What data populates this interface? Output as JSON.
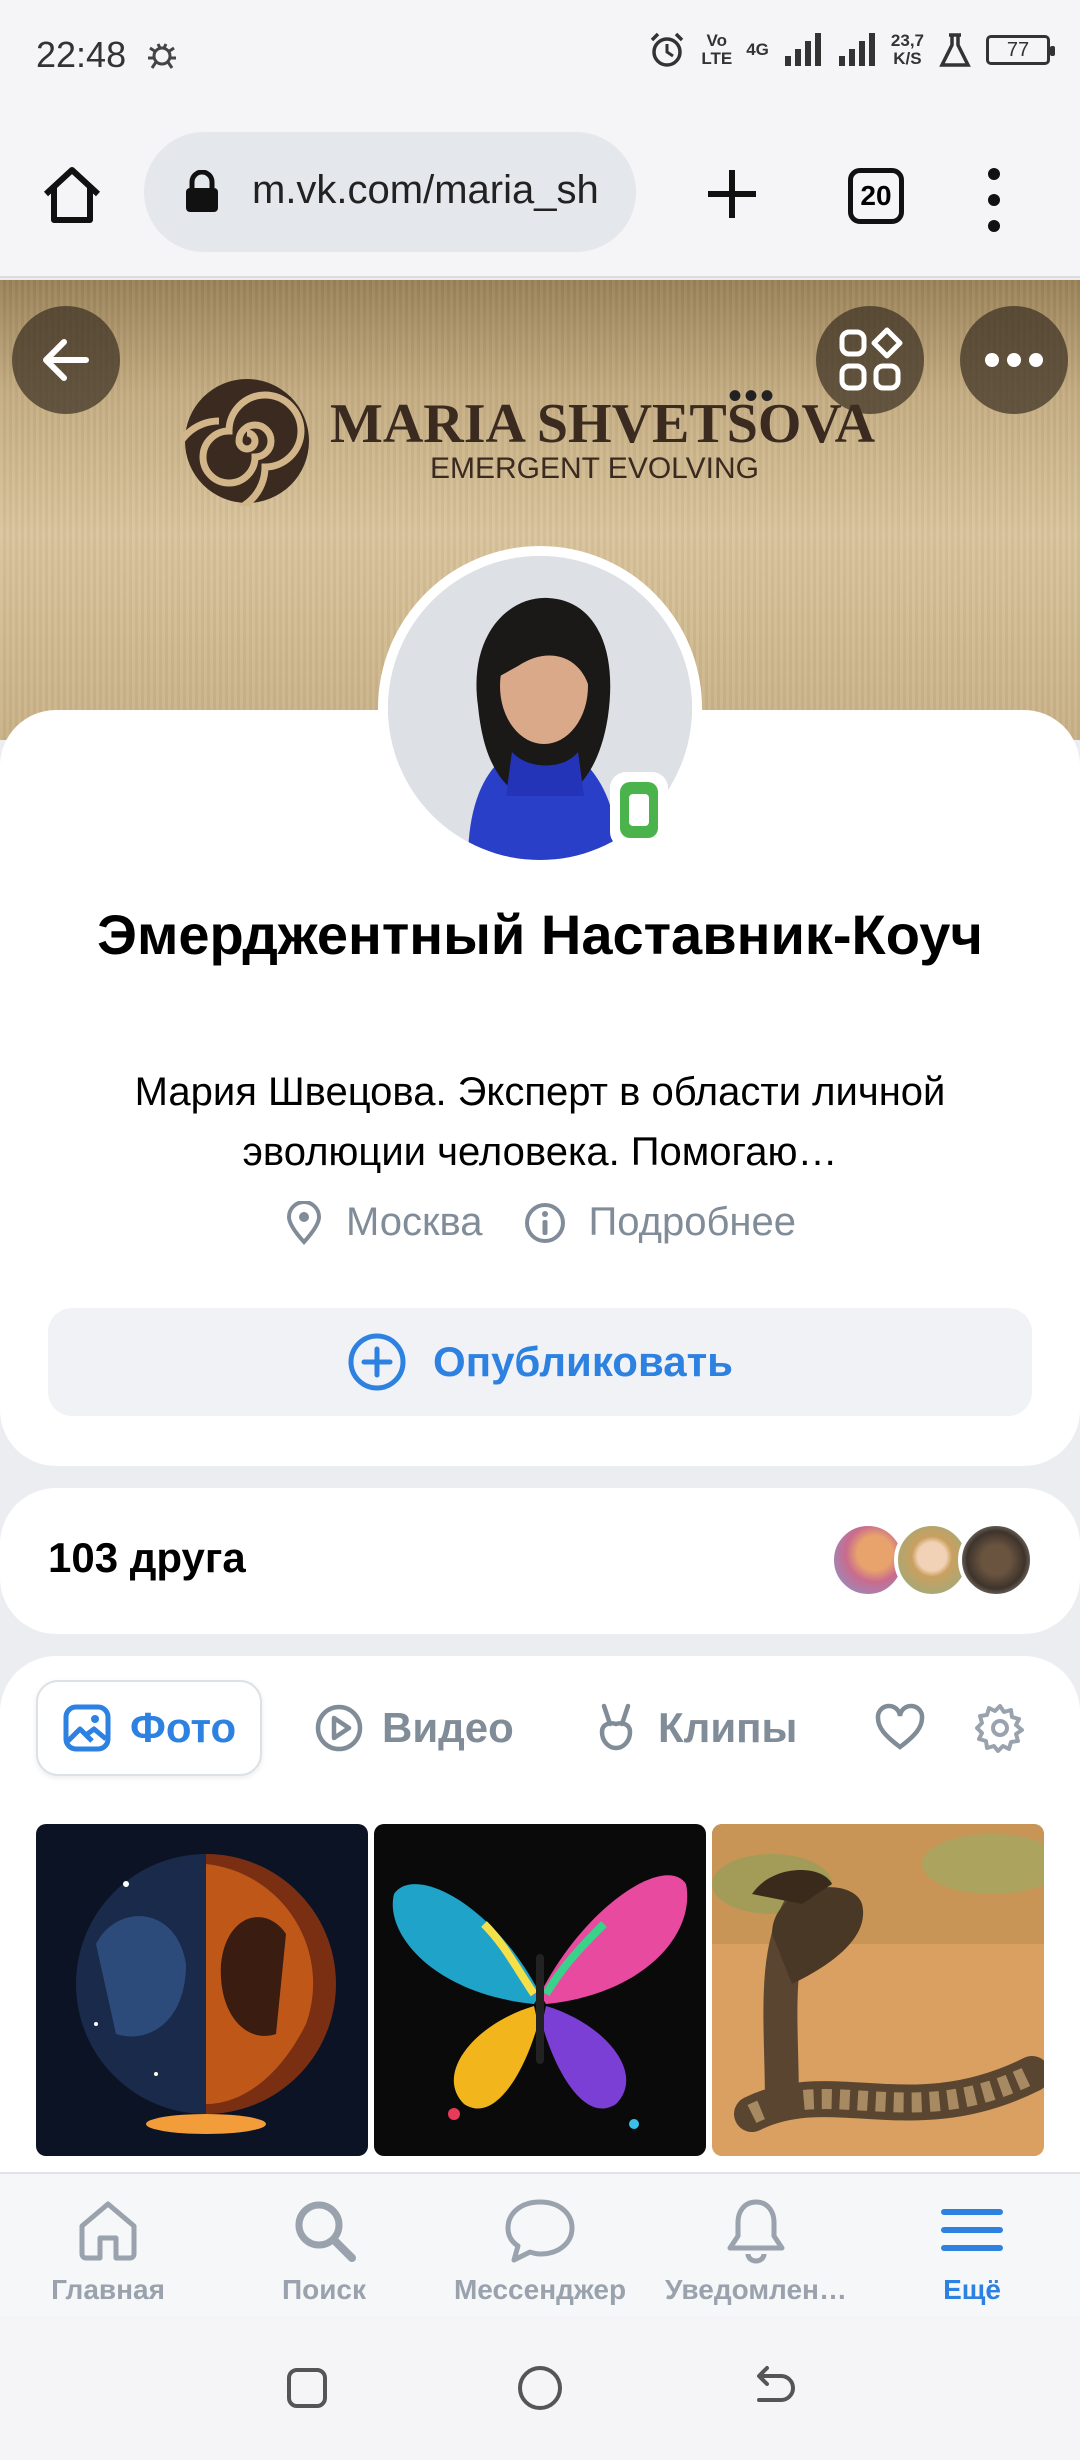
{
  "status_bar": {
    "time": "22:48",
    "network_vo": "Vo",
    "network_lte": "LTE",
    "network_4g": "4G",
    "speed_value": "23,7",
    "speed_unit": "K/S",
    "battery": "77"
  },
  "browser": {
    "url": "m.vk.com/maria_sh",
    "tab_count": "20"
  },
  "cover": {
    "logo_title": "MARIA SHVETSOVA",
    "logo_subtitle": "EMERGENT EVOLVING"
  },
  "profile": {
    "name": "Эмерджентный Наставник-Коуч",
    "status": "Мария Швецова. Эксперт в области личной эволюции человека. Помогаю…",
    "city": "Москва",
    "details_link": "Подробнее",
    "publish_label": "Опубликовать",
    "online": true
  },
  "friends": {
    "label": "103 друга"
  },
  "media_tabs": [
    {
      "label": "Фото",
      "icon": "photo-icon",
      "active": true
    },
    {
      "label": "Видео",
      "icon": "video-play-icon",
      "active": false
    },
    {
      "label": "Клипы",
      "icon": "clips-icon",
      "active": false
    }
  ],
  "photos": [
    {
      "name": "photo-lovers-cosmic"
    },
    {
      "name": "photo-colorful-butterfly"
    },
    {
      "name": "photo-cobra"
    }
  ],
  "bottom_nav": [
    {
      "label": "Главная",
      "icon": "home-icon",
      "active": false
    },
    {
      "label": "Поиск",
      "icon": "search-icon",
      "active": false
    },
    {
      "label": "Мессенджер",
      "icon": "messenger-icon",
      "active": false
    },
    {
      "label": "Уведомлен…",
      "icon": "bell-icon",
      "active": false
    },
    {
      "label": "Ещё",
      "icon": "menu-icon",
      "active": true
    }
  ],
  "colors": {
    "accent": "#2d81e0",
    "online": "#4bb34b",
    "secondary_text": "#818c99",
    "nav_inactive": "#99a2ad"
  }
}
